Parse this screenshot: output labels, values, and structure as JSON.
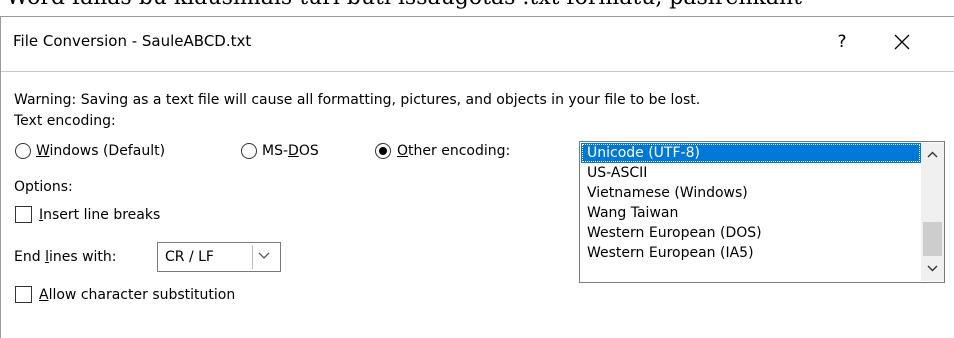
{
  "background_text": "Word failas bu klausimais  turi būti išsaugotas .txt formatu, pasirenkant",
  "dialog": {
    "title": "File Conversion - SauleABCD.txt",
    "help_label": "?",
    "close_icon": "close-icon"
  },
  "warning": "Warning: Saving as a text file will cause all formatting, pictures, and objects in your file to be lost.",
  "text_encoding": {
    "label": "Text encoding:",
    "options": [
      {
        "pre": "",
        "key": "W",
        "post": "indows (Default)",
        "checked": false
      },
      {
        "pre": "MS-",
        "key": "D",
        "post": "OS",
        "checked": false
      },
      {
        "pre": "",
        "key": "O",
        "post": "ther encoding:",
        "checked": true
      }
    ]
  },
  "options": {
    "label": "Options:",
    "insert_line_breaks": {
      "key": "I",
      "rest": "nsert line breaks",
      "checked": false
    },
    "end_lines": {
      "pre": "End ",
      "key": "l",
      "post": "ines with:",
      "value": "CR / LF"
    },
    "allow_substitution": {
      "key": "A",
      "rest": "llow character substitution",
      "checked": false
    }
  },
  "encoding_list": {
    "items": [
      "Unicode (UTF-8)",
      "US-ASCII",
      "Vietnamese (Windows)",
      "Wang Taiwan",
      "Western European (DOS)",
      "Western European (IA5)"
    ],
    "selected": "Unicode (UTF-8)"
  },
  "colors": {
    "selection": "#0078d7",
    "scrollbar_thumb": "#cdcdcd"
  }
}
